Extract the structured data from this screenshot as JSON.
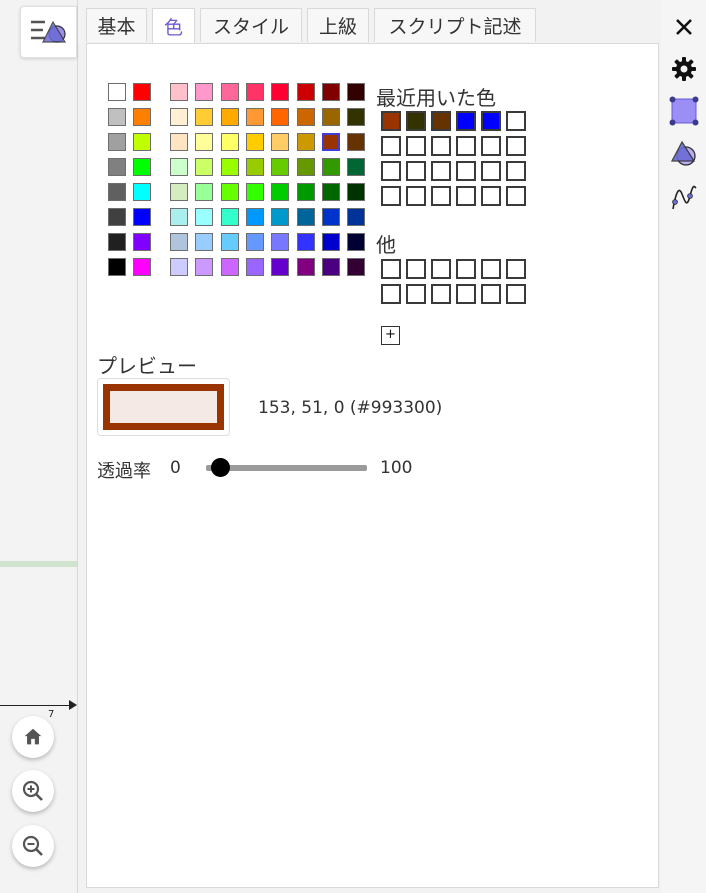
{
  "tabs": [
    {
      "label": "基本"
    },
    {
      "label": "色"
    },
    {
      "label": "スタイル"
    },
    {
      "label": "上級"
    },
    {
      "label": "スクリプト記述"
    }
  ],
  "active_tab": "色",
  "palette": {
    "gray_columns": [
      [
        "#ffffff",
        "#c0c0c0",
        "#a0a0a0",
        "#808080",
        "#606060",
        "#404040",
        "#202020",
        "#000000"
      ],
      [
        "#ff0000",
        "#ff8000",
        "#c0ff00",
        "#00ff00",
        "#00ffff",
        "#0000ff",
        "#8000ff",
        "#ff00ff"
      ]
    ],
    "color_grid": [
      [
        "#ffc0cb",
        "#ff99cc",
        "#ff6699",
        "#ff3366",
        "#ff0033",
        "#cc0000",
        "#800000",
        "#330000"
      ],
      [
        "#ffefd5",
        "#ffcc33",
        "#ffaa00",
        "#ff9933",
        "#ff6600",
        "#cc6600",
        "#996600",
        "#333300"
      ],
      [
        "#ffe4c4",
        "#ffff99",
        "#ffff66",
        "#ffcc00",
        "#ffcc66",
        "#cc9900",
        "#993300",
        "#663300"
      ],
      [
        "#ccffcc",
        "#ccff66",
        "#99ff00",
        "#99cc00",
        "#66cc00",
        "#669900",
        "#339900",
        "#006633"
      ],
      [
        "#d4ecc0",
        "#99ff99",
        "#66ff00",
        "#33ff00",
        "#00cc00",
        "#009900",
        "#006600",
        "#003300"
      ],
      [
        "#aaeeee",
        "#99ffff",
        "#33ffcc",
        "#0099ff",
        "#0099cc",
        "#006699",
        "#0033cc",
        "#003399"
      ],
      [
        "#b0c4de",
        "#99ccff",
        "#66ccff",
        "#6699ff",
        "#7777ff",
        "#3333ff",
        "#0000cc",
        "#000033"
      ],
      [
        "#ccccff",
        "#cc99ff",
        "#cc66ff",
        "#9966ff",
        "#6600cc",
        "#800080",
        "#4b0082",
        "#330033"
      ]
    ],
    "selected_color": "#993300"
  },
  "recent_colors_label": "最近用いた色",
  "recent_colors": [
    "#993300",
    "#333300",
    "#663300",
    "#0000ff",
    "#0000ff",
    "#ffffff"
  ],
  "other_label": "他",
  "plus_label": "+",
  "preview_label": "プレビュー",
  "preview_color": "#993300",
  "preview_fill": "#f5e9e6",
  "rgb_text": "153, 51, 0 (#993300)",
  "opacity": {
    "label": "透過率",
    "min": "0",
    "max": "100",
    "value": 0.09
  },
  "axis_tick_label": "7",
  "right_toolbar": [
    "close-icon",
    "gear-icon",
    "polygon-style-icon",
    "shapes-icon",
    "curve-icon"
  ],
  "left_controls": [
    "home-icon",
    "zoom-in-icon",
    "zoom-out-icon"
  ],
  "accent_color": "#6b5bd6"
}
